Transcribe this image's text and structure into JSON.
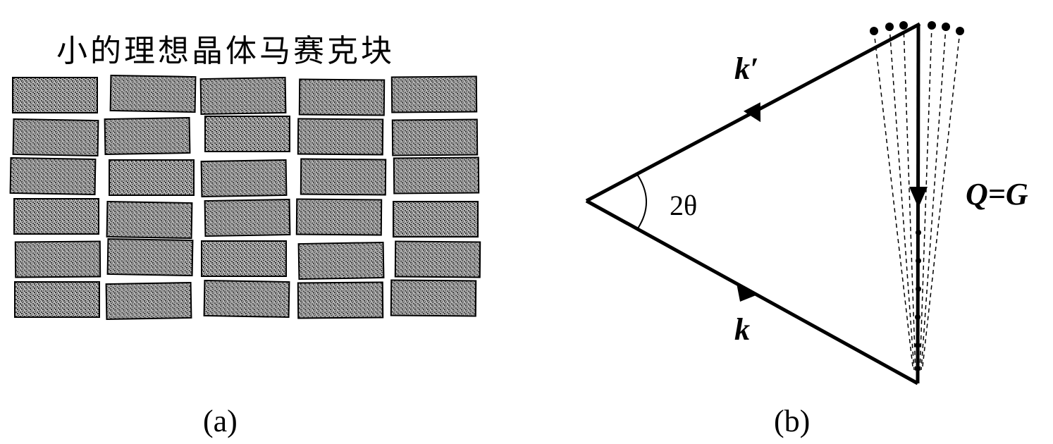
{
  "panel_a": {
    "title": "小的理想晶体马赛克块",
    "caption": "(a)",
    "block_rows": 6,
    "blocks_per_row": 5,
    "block_color": "#888888"
  },
  "panel_b": {
    "caption": "(b)",
    "angle_label": "2θ",
    "k_prime_label": "k′",
    "k_label": "k",
    "q_label": "Q=G"
  }
}
